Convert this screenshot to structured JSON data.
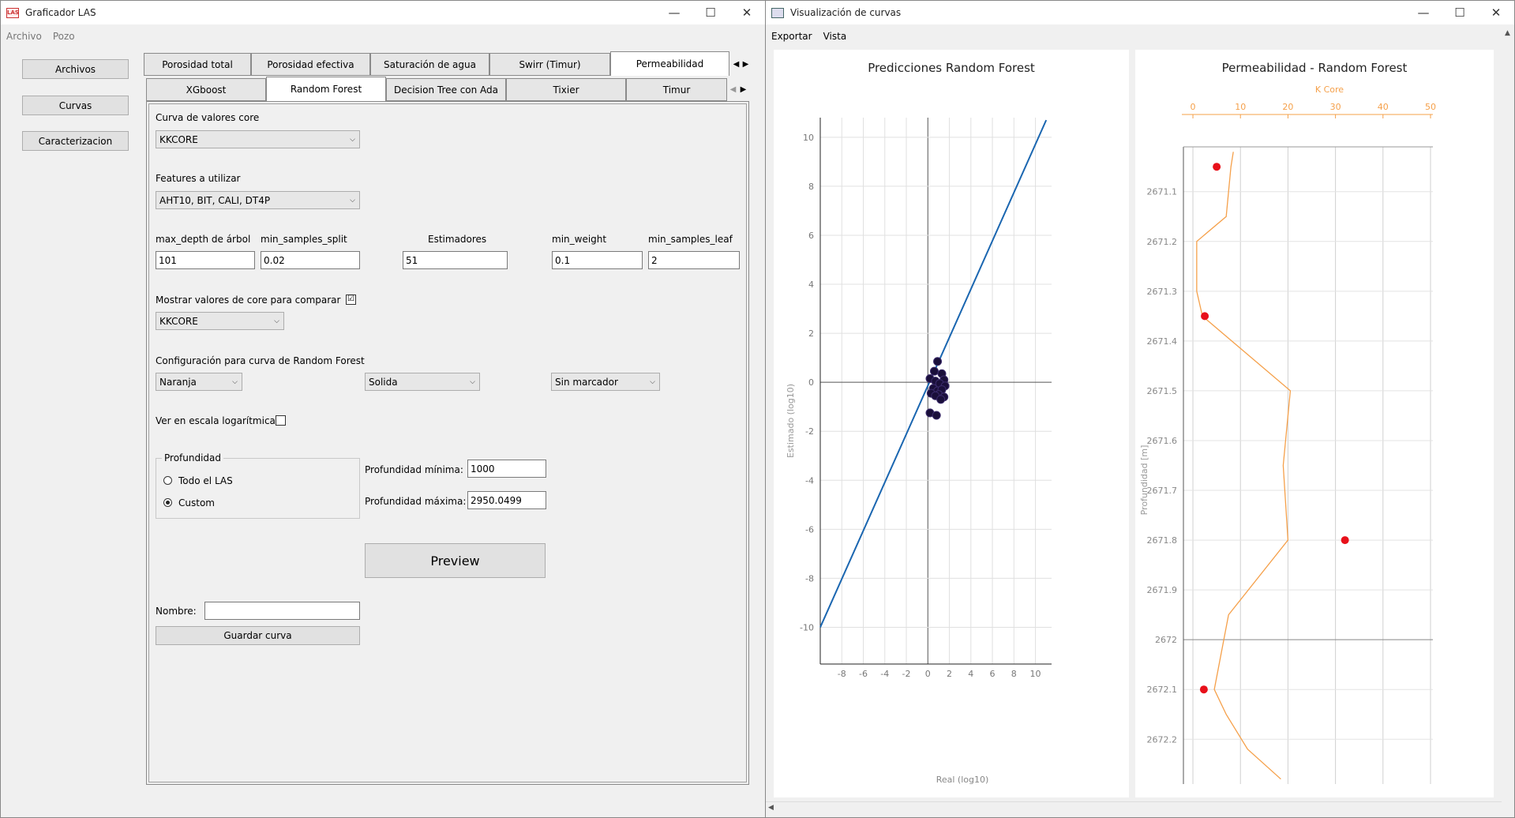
{
  "left_window": {
    "title": "Graficador LAS",
    "menu": [
      "Archivo",
      "Pozo"
    ],
    "side_buttons": [
      "Archivos",
      "Curvas",
      "Caracterizacion"
    ],
    "tabs_top": [
      "Porosidad total",
      "Porosidad efectiva",
      "Saturación de agua",
      "Swirr (Timur)",
      "Permeabilidad"
    ],
    "tabs_sub": [
      "XGboost",
      "Random Forest",
      "Decision Tree con Ada",
      "Tixier",
      "Timur"
    ],
    "form": {
      "core_curve_label": "Curva de valores core",
      "core_curve_value": "KKCORE",
      "features_label": "Features a utilizar",
      "features_value": "AHT10, BIT, CALI, DT4P",
      "params": [
        {
          "label": "max_depth de árbol",
          "value": "101"
        },
        {
          "label": "min_samples_split",
          "value": "0.02"
        },
        {
          "label": "Estimadores",
          "value": "51"
        },
        {
          "label": "min_weight",
          "value": "0.1"
        },
        {
          "label": "min_samples_leaf",
          "value": "2"
        }
      ],
      "show_core_label": "Mostrar valores de core para comparar",
      "show_core_checked": "☑",
      "show_core_value": "KKCORE",
      "config_label": "Configuración para curva de Random Forest",
      "color_value": "Naranja",
      "line_value": "Solida",
      "marker_value": "Sin marcador",
      "log_scale_label": "Ver en escala logarítmica",
      "depth_group_label": "Profundidad",
      "depth_all_label": "Todo el LAS",
      "depth_custom_label": "Custom",
      "depth_min_label": "Profundidad mínima:",
      "depth_min_value": "1000",
      "depth_max_label": "Profundidad máxima:",
      "depth_max_value": "2950.0499",
      "preview_label": "Preview",
      "name_label": "Nombre:",
      "name_value": "",
      "save_label": "Guardar curva"
    }
  },
  "right_window": {
    "title": "Visualización de curvas",
    "menu": [
      "Exportar",
      "Vista"
    ]
  },
  "chart_data": [
    {
      "type": "scatter",
      "title": "Predicciones Random Forest",
      "xlabel": "Real (log10)",
      "ylabel": "Estimado (log10)",
      "xlim": [
        -10,
        11.5
      ],
      "ylim": [
        -11.5,
        10.8
      ],
      "xticks": [
        -8,
        -6,
        -4,
        -2,
        0,
        2,
        4,
        6,
        8,
        10
      ],
      "yticks": [
        -10,
        -8,
        -6,
        -4,
        -2,
        0,
        2,
        4,
        6,
        8,
        10
      ],
      "grid": true,
      "reference_line": {
        "x": [
          -10,
          11
        ],
        "y": [
          -10,
          10.7
        ]
      },
      "points": {
        "x": [
          0.9,
          0.6,
          1.3,
          0.2,
          1.5,
          0.7,
          1.1,
          1.6,
          0.5,
          0.9,
          1.3,
          0.3,
          1.0,
          1.5,
          0.7,
          1.2,
          0.2,
          0.8
        ],
        "y": [
          0.85,
          0.45,
          0.35,
          0.15,
          0.1,
          0.05,
          -0.05,
          -0.15,
          -0.25,
          -0.35,
          -0.3,
          -0.45,
          -0.5,
          -0.6,
          -0.55,
          -0.7,
          -1.25,
          -1.35
        ]
      }
    },
    {
      "type": "line",
      "title": "Permeabilidad - Random Forest",
      "top_axis_label": "K Core",
      "ylabel": "Profundidad [m]",
      "xlim": [
        -2,
        50.5
      ],
      "xticks": [
        0,
        10,
        20,
        30,
        40,
        50
      ],
      "ylim": [
        2672.29,
        2671.01
      ],
      "yticks": [
        "2671.1",
        "2671.2",
        "2671.3",
        "2671.4",
        "2671.5",
        "2671.6",
        "2671.7",
        "2671.8",
        "2671.9",
        "2672",
        "2672.1",
        "2672.2"
      ],
      "grid": true,
      "series": [
        {
          "type": "line",
          "color": "#f5a04a",
          "x": [
            8.5,
            8,
            7.5,
            7,
            0.8,
            0.8,
            2,
            20.5,
            19,
            20,
            7.5,
            4.5,
            7,
            11.5,
            18.5
          ],
          "depth": [
            2671.02,
            2671.05,
            2671.1,
            2671.15,
            2671.2,
            2671.3,
            2671.35,
            2671.5,
            2671.65,
            2671.8,
            2671.95,
            2672.1,
            2672.15,
            2672.22,
            2672.28
          ]
        },
        {
          "type": "scatter",
          "color": "#e8101a",
          "x": [
            5,
            2.5,
            32,
            2.3
          ],
          "depth": [
            2671.05,
            2671.35,
            2671.8,
            2672.1
          ]
        }
      ]
    }
  ]
}
